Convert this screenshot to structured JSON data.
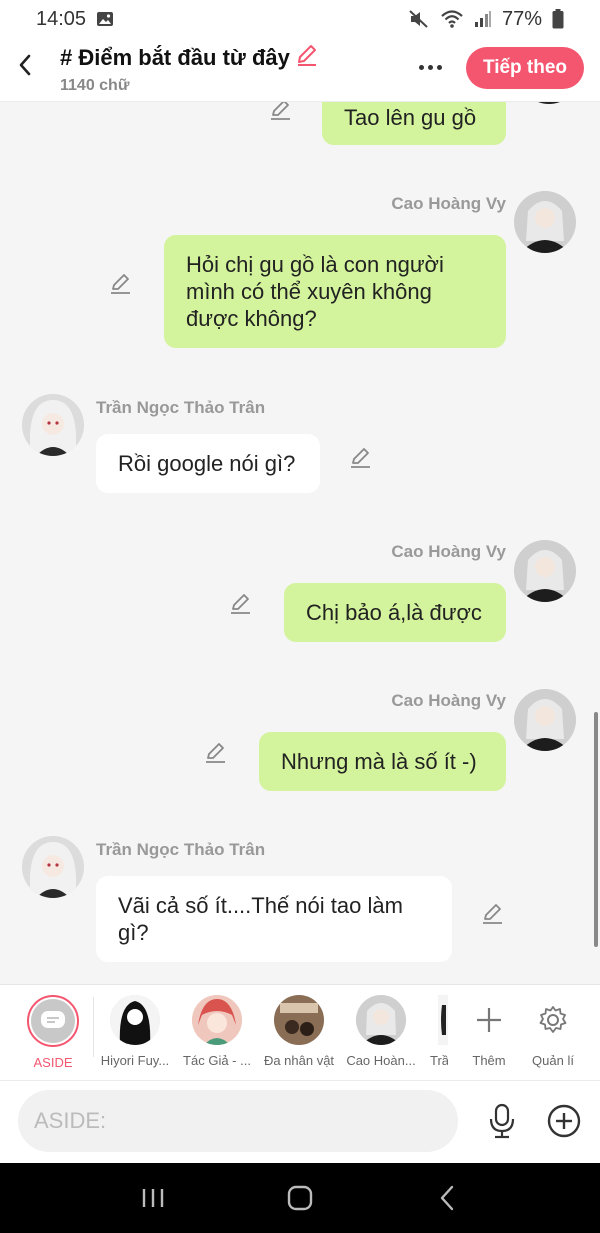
{
  "status_bar": {
    "time": "14:05",
    "battery": "77%",
    "icons": [
      "image-icon",
      "mute-icon",
      "wifi-icon",
      "signal-icon",
      "battery-icon"
    ]
  },
  "header": {
    "title": "# Điểm bắt đầu từ đây",
    "subtitle": "1140 chữ",
    "next_label": "Tiếp theo",
    "accent": "#f5566f"
  },
  "messages": [
    {
      "side": "right",
      "sender": "",
      "text_lines": [
        "Tao lên gu gồ"
      ]
    },
    {
      "side": "right",
      "sender": "Cao Hoàng Vy",
      "text_lines": [
        "Hỏi chị gu gồ là con người",
        "mình có thể xuyên không",
        "được không?"
      ]
    },
    {
      "side": "left",
      "sender": "Trần Ngọc Thảo Trân",
      "text_lines": [
        "Rồi google nói gì?"
      ]
    },
    {
      "side": "right",
      "sender": "Cao Hoàng Vy",
      "text_lines": [
        "Chị bảo á,là được"
      ]
    },
    {
      "side": "right",
      "sender": "Cao Hoàng Vy",
      "text_lines": [
        "Nhưng mà là số ít -)"
      ]
    },
    {
      "side": "left",
      "sender": "Trần Ngọc Thảo Trân",
      "text_lines": [
        "Vãi cả số ít....Thế nói tao làm",
        "gì?"
      ]
    }
  ],
  "colors": {
    "right_bubble": "#d3f49c",
    "left_bubble": "#ffffff",
    "background": "#f5f5f5"
  },
  "characters": [
    {
      "label": "ASIDE"
    },
    {
      "label": "Hiyori Fuy..."
    },
    {
      "label": "Tác Giả - ..."
    },
    {
      "label": "Đa nhân vật"
    },
    {
      "label": "Cao Hoàn..."
    },
    {
      "label": "Trầ"
    }
  ],
  "char_actions": {
    "add_label": "Thêm",
    "manage_label": "Quản lí"
  },
  "input": {
    "placeholder": "ASIDE:",
    "value": ""
  }
}
